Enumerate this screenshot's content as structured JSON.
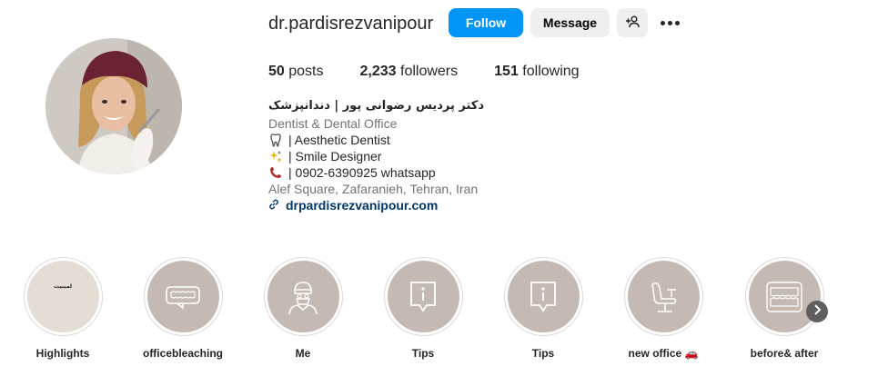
{
  "profile": {
    "username": "dr.pardisrezvanipour",
    "follow_label": "Follow",
    "message_label": "Message",
    "add_user_icon": "person-add-icon",
    "more_icon": "more-options-icon"
  },
  "stats": {
    "posts_count": "50",
    "posts_label": "posts",
    "followers_count": "2,233",
    "followers_label": "followers",
    "following_count": "151",
    "following_label": "following"
  },
  "bio": {
    "full_name": "دکتر پردیس رضوانی پور | دندانپزشک",
    "category": "Dentist & Dental Office",
    "lines": [
      {
        "icon": "tooth-icon",
        "text": "| Aesthetic Dentist"
      },
      {
        "icon": "sparkles-icon",
        "text": "| Smile Designer"
      },
      {
        "icon": "telephone-icon",
        "text": "| 0902-6390925 whatsapp"
      }
    ],
    "address": "Alef Square, Zafaranieh, Tehran, Iran",
    "link": "drpardisrezvanipour.com"
  },
  "highlights": [
    {
      "label": "Highlights",
      "icon": "text-cover-icon",
      "cover_text": "لمینیت"
    },
    {
      "label": "officebleaching",
      "icon": "teeth-speech-bubble-icon"
    },
    {
      "label": "Me",
      "icon": "dentist-avatar-icon"
    },
    {
      "label": "Tips",
      "icon": "info-bubble-icon"
    },
    {
      "label": "Tips",
      "icon": "info-bubble-icon"
    },
    {
      "label": "new office 🚗",
      "icon": "dental-chair-icon"
    },
    {
      "label": "before& after",
      "icon": "teeth-rows-icon"
    }
  ],
  "colors": {
    "follow_button": "#0095f6",
    "secondary_button": "#efefef",
    "highlight_fill": "#c5b9b4",
    "link": "#00376b"
  }
}
